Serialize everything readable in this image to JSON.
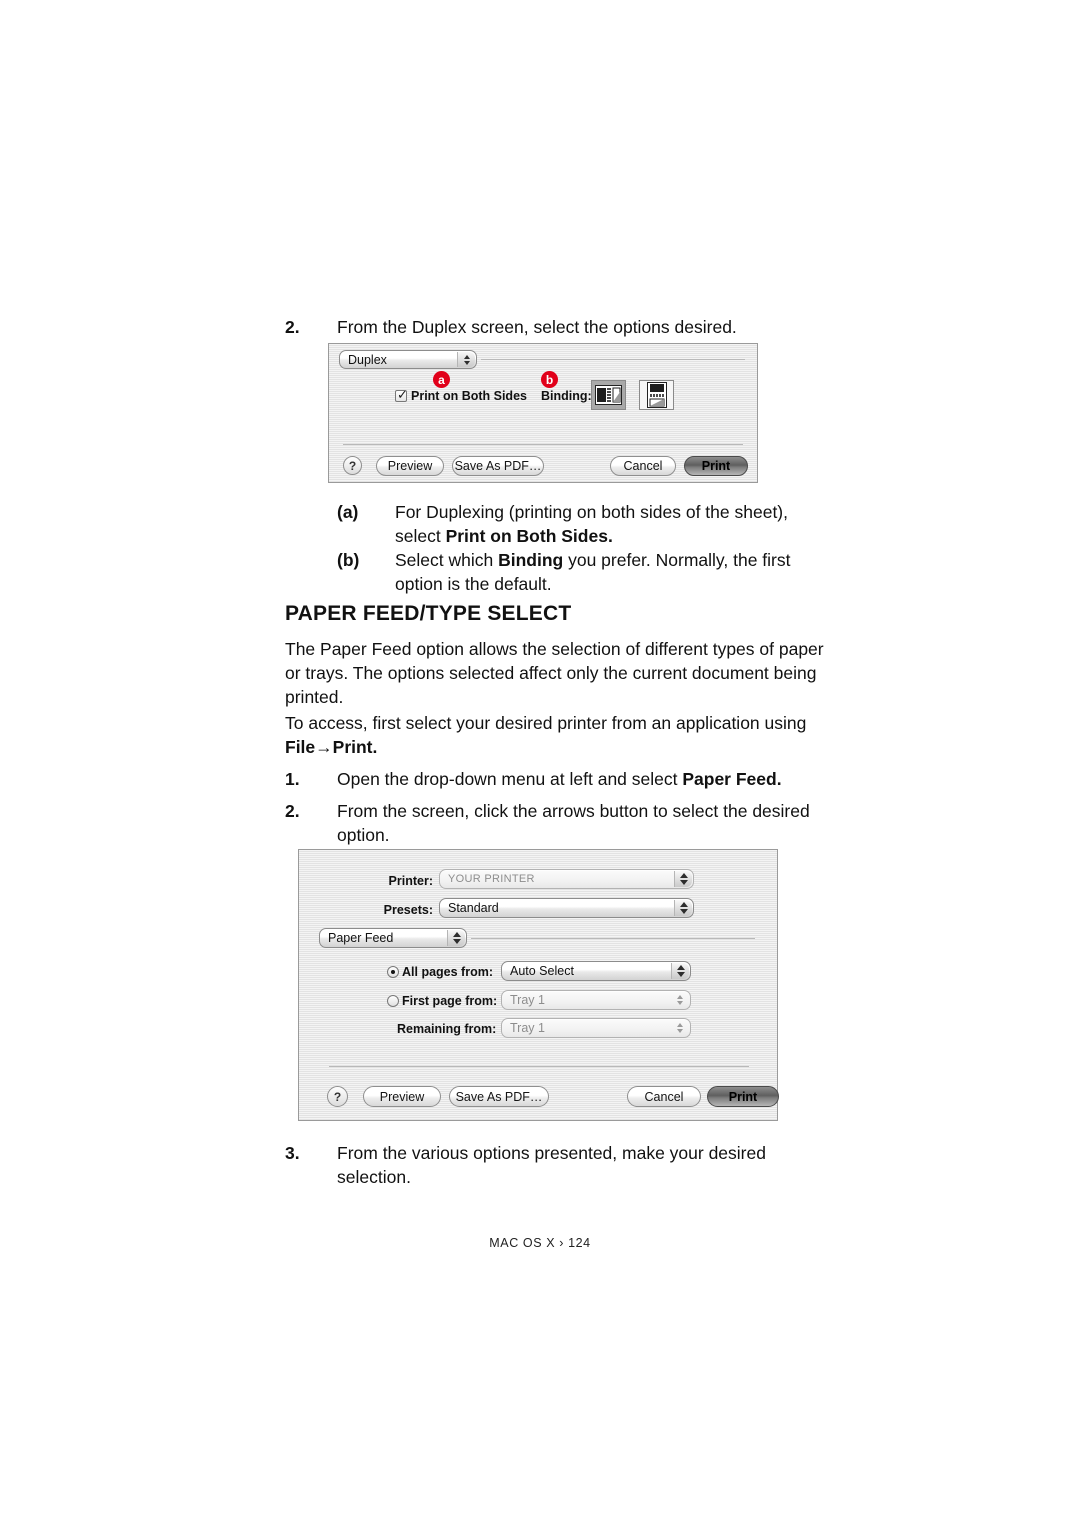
{
  "document": {
    "footer": "MAC OS X › 124"
  },
  "step2_duplex": {
    "number": "2.",
    "text": "From the Duplex screen, select the options desired."
  },
  "duplex_dialog": {
    "pane_popup": {
      "label": "Duplex"
    },
    "print_both_sides": {
      "label": "Print on Both Sides",
      "checked": true
    },
    "binding": {
      "label": "Binding:",
      "options": [
        "binding-landscape-icon",
        "binding-portrait-icon"
      ],
      "selected_index": 0
    },
    "callouts": [
      {
        "id": "a",
        "target": "print-on-both-sides"
      },
      {
        "id": "b",
        "target": "binding"
      }
    ],
    "buttons": {
      "help": "?",
      "preview": "Preview",
      "save_as_pdf": "Save As PDF…",
      "cancel": "Cancel",
      "print": "Print"
    }
  },
  "sub_steps": [
    {
      "marker": "(a)",
      "line1_pre": "For Duplexing (printing on both sides of the sheet),",
      "line2_pre": "select ",
      "line2_bold": "Print on Both Sides.",
      "line2_post": ""
    },
    {
      "marker": "(b)",
      "line1_pre": "Select which ",
      "line1_bold": "Binding",
      "line1_post": " you prefer. Normally, the first",
      "line2_pre": "option is the default.",
      "line2_bold": "",
      "line2_post": ""
    }
  ],
  "section": {
    "heading": "PAPER FEED/TYPE SELECT",
    "para1": "The Paper Feed option allows the selection of different types of paper or trays. The options selected affect only the current document being printed.",
    "para2_pre": "To access, first select your desired printer from an application using ",
    "para2_bold": "File→Print."
  },
  "paper_feed_steps": [
    {
      "number": "1.",
      "pre": "Open the drop-down menu at left and select ",
      "bold": "Paper Feed.",
      "post": ""
    },
    {
      "number": "2.",
      "pre": "From the screen, click the arrows button to select the desired option.",
      "bold": "",
      "post": ""
    }
  ],
  "step3": {
    "number": "3.",
    "text": "From the various options presented, make your desired selection."
  },
  "paper_feed_dialog": {
    "printer": {
      "label": "Printer:",
      "value": "YOUR PRINTER"
    },
    "presets": {
      "label": "Presets:",
      "value": "Standard"
    },
    "pane_popup": {
      "label": "Paper Feed"
    },
    "all_pages": {
      "label": "All pages from:",
      "value": "Auto Select",
      "selected": true
    },
    "first_page": {
      "label": "First page from:",
      "value": "Tray 1",
      "selected": false,
      "enabled": false
    },
    "remaining": {
      "label": "Remaining from:",
      "value": "Tray 1",
      "enabled": false
    },
    "buttons": {
      "help": "?",
      "preview": "Preview",
      "save_as_pdf": "Save As PDF…",
      "cancel": "Cancel",
      "print": "Print"
    }
  },
  "colors": {
    "callout_red": "#e1001a",
    "text": "#111111",
    "dialog_bg": "#ececec"
  }
}
